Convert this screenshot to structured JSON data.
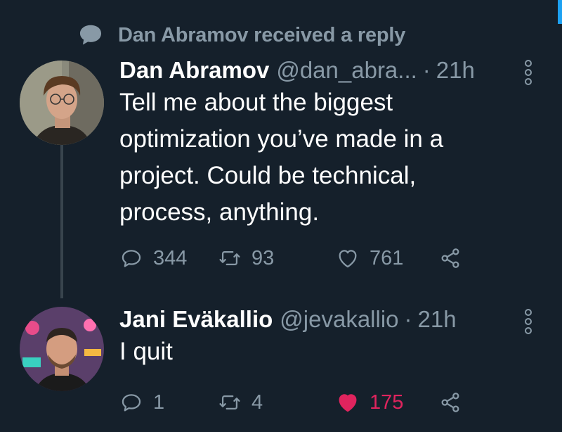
{
  "context": {
    "text": "Dan Abramov received a reply"
  },
  "tweets": [
    {
      "name": "Dan Abramov",
      "handle": "@dan_abra...",
      "dot": "·",
      "time": "21h",
      "text": "Tell me about the biggest optimization you’ve made in a project. Could be technical, process, anything.",
      "reply_count": "344",
      "retweet_count": "93",
      "like_count": "761",
      "liked": false
    },
    {
      "name": "Jani Eväkallio",
      "handle": "@jevakallio",
      "dot": "·",
      "time": "21h",
      "text": "I quit",
      "reply_count": "1",
      "retweet_count": "4",
      "like_count": "175",
      "liked": true
    }
  ],
  "colors": {
    "background": "#15202b",
    "muted": "#8899a6",
    "like_active": "#e0245e",
    "thread_line": "#38444d",
    "accent": "#1da1f2"
  },
  "icons": [
    "speech-bubble-icon",
    "reply-icon",
    "retweet-icon",
    "heart-icon",
    "share-icon",
    "more-options-icon"
  ]
}
